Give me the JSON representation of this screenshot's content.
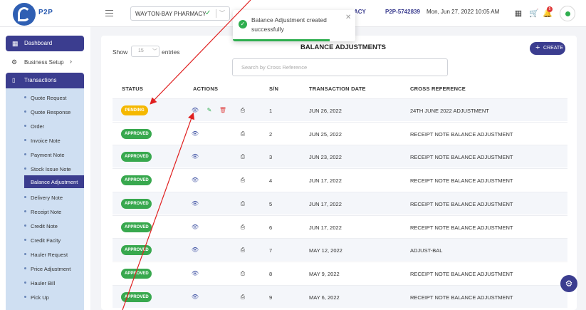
{
  "header": {
    "brand": "P2P",
    "pharmacy": {
      "selected": "WAYTON-BAY PHARMACY"
    },
    "account_suffix": "ACY",
    "account_id": "P2P-5742839",
    "datetime": "Mon, Jun 27, 2022 10:05 AM",
    "notification_count": "5"
  },
  "toast": {
    "message": "Balance Adjustment created successfully",
    "progress": 0.79
  },
  "sidebar": {
    "dashboard": "Dashboard",
    "business_setup": "Business Setup",
    "transactions": "Transactions",
    "items": [
      "Quote Request",
      "Quote Response",
      "Order",
      "Invoice Note",
      "Payment Note",
      "Stock Issue Note",
      "Balance Adjustment",
      "Delivery Note",
      "Receipt Note",
      "Credit Note",
      "Credit Facity",
      "Hauler Request",
      "Price Adjustment",
      "Hauler Bill",
      "Pick Up"
    ],
    "active_item": "Balance Adjustment"
  },
  "main": {
    "title": "BALANCE ADJUSTMENTS",
    "create_label": "CREATE",
    "show_label": "Show",
    "entries_value": "15",
    "entries_label": "entries",
    "search_placeholder": "Search by Cross Reference",
    "columns": [
      "STATUS",
      "ACTIONS",
      "S/N",
      "TRANSACTION DATE",
      "CROSS REFERENCE"
    ],
    "rows": [
      {
        "status": "PENDING",
        "sn": "1",
        "date": "JUN 26, 2022",
        "ref": "24TH JUNE 2022 ADJUSTMENT"
      },
      {
        "status": "APPROVED",
        "sn": "2",
        "date": "JUN 25, 2022",
        "ref": "RECEIPT NOTE BALANCE ADJUSTMENT"
      },
      {
        "status": "APPROVED",
        "sn": "3",
        "date": "JUN 23, 2022",
        "ref": "RECEIPT NOTE BALANCE ADJUSTMENT"
      },
      {
        "status": "APPROVED",
        "sn": "4",
        "date": "JUN 17, 2022",
        "ref": "RECEIPT NOTE BALANCE ADJUSTMENT"
      },
      {
        "status": "APPROVED",
        "sn": "5",
        "date": "JUN 17, 2022",
        "ref": "RECEIPT NOTE BALANCE ADJUSTMENT"
      },
      {
        "status": "APPROVED",
        "sn": "6",
        "date": "JUN 17, 2022",
        "ref": "RECEIPT NOTE BALANCE ADJUSTMENT"
      },
      {
        "status": "APPROVED",
        "sn": "7",
        "date": "MAY 12, 2022",
        "ref": "ADJUST-BAL"
      },
      {
        "status": "APPROVED",
        "sn": "8",
        "date": "MAY 9, 2022",
        "ref": "RECEIPT NOTE BALANCE ADJUSTMENT"
      },
      {
        "status": "APPROVED",
        "sn": "9",
        "date": "MAY 6, 2022",
        "ref": "RECEIPT NOTE BALANCE ADJUSTMENT"
      }
    ]
  },
  "colors": {
    "primary": "#3b3d8f",
    "pending": "#f5b800",
    "approved": "#38a84e",
    "success": "#2fae4f",
    "annotation_arrow": "#e02020"
  },
  "icons": {
    "row_view": "eye-icon",
    "row_edit": "pencil-icon",
    "row_delete": "trash-icon",
    "row_print": "printer-icon"
  }
}
